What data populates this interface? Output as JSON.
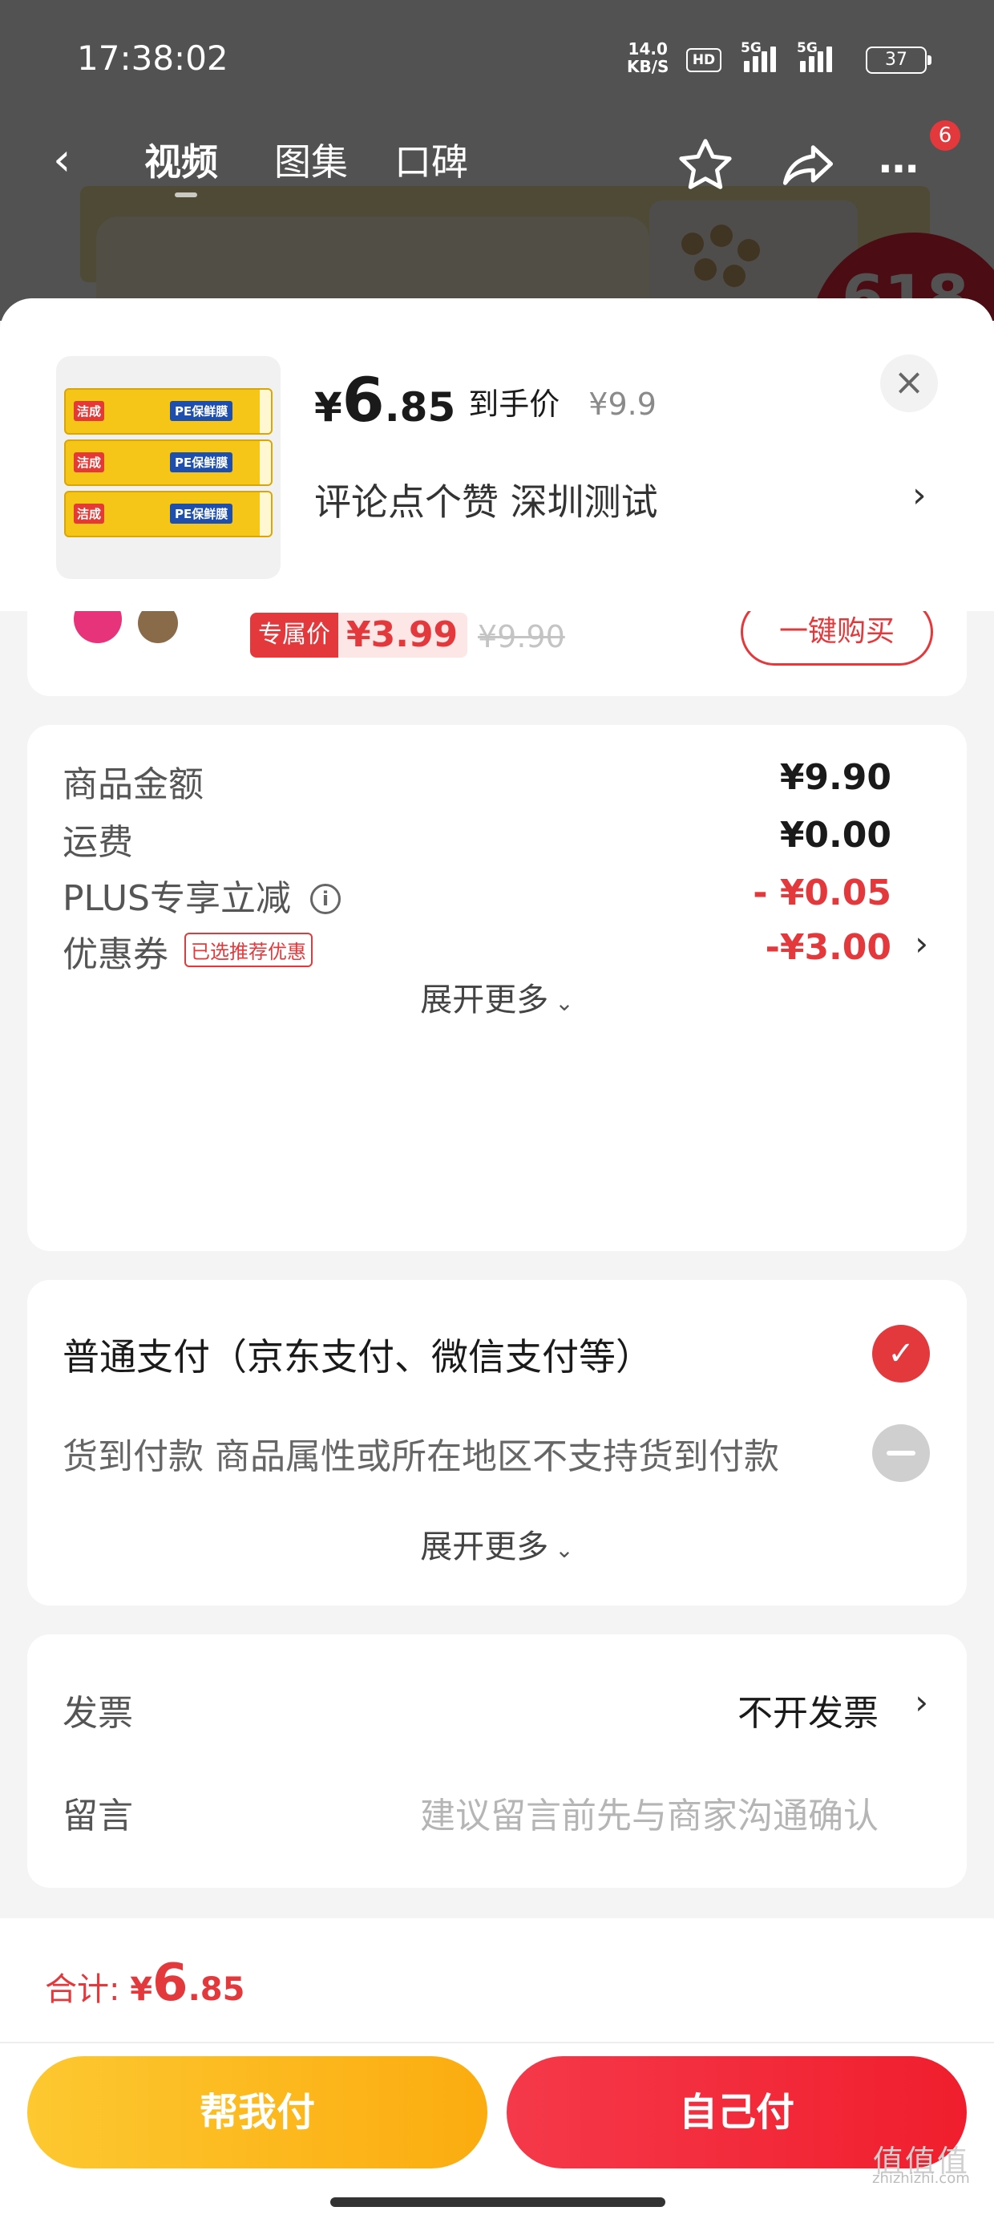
{
  "status_bar": {
    "time": "17:38:02",
    "net_speed_value": "14.0",
    "net_speed_unit": "KB/S",
    "hd_badge": "HD",
    "signal1_tag": "5G",
    "signal2_tag": "5G",
    "battery": "37"
  },
  "nav": {
    "tabs": [
      "视频",
      "图集",
      "口碑"
    ],
    "message_badge": "6"
  },
  "background": {
    "promo_badge": "618"
  },
  "sheet_header": {
    "price_yen": "¥",
    "price_int": "6",
    "price_dec": ".85",
    "price_tag": "到手价",
    "original_price": "¥9.9",
    "note": "评论点个赞  深圳测试",
    "product_brand": "洁成",
    "product_text": "PE保鲜膜"
  },
  "peek": {
    "exclusive_label": "专属价",
    "exclusive_price": "¥3.99",
    "exclusive_orig": "¥9.90",
    "buy_button": "一键购买"
  },
  "price_details": {
    "rows": [
      {
        "label": "商品金额",
        "value": "¥9.90"
      },
      {
        "label": "运费",
        "value": "¥0.00"
      },
      {
        "label": "PLUS专享立减",
        "value": "- ¥0.05"
      },
      {
        "label": "优惠券",
        "badge": "已选推荐优惠",
        "value": "-¥3.00"
      }
    ],
    "expand": "展开更多"
  },
  "payment": {
    "normal": "普通支付（京东支付、微信支付等）",
    "cod": "货到付款 商品属性或所在地区不支持货到付款",
    "expand": "展开更多"
  },
  "misc": {
    "invoice_label": "发票",
    "invoice_value": "不开发票",
    "message_label": "留言",
    "message_placeholder": "建议留言前先与商家沟通确认"
  },
  "bottom": {
    "total_label": "合计: ",
    "total_yen": "¥",
    "total_int": "6",
    "total_dec": ".85",
    "help_pay": "帮我付",
    "self_pay": "自己付"
  },
  "watermark": {
    "logo": "值值值",
    "url": "zhizhizhi.com"
  },
  "colors": {
    "accent_red": "#e4393c",
    "help_button": "#fbac0f",
    "self_button": "#f01e2d"
  },
  "icons": [
    "back-icon",
    "star-icon",
    "share-icon",
    "more-icon",
    "close-icon",
    "info-icon",
    "chevron-right-icon",
    "chevron-down-icon",
    "check-icon",
    "minus-icon"
  ]
}
